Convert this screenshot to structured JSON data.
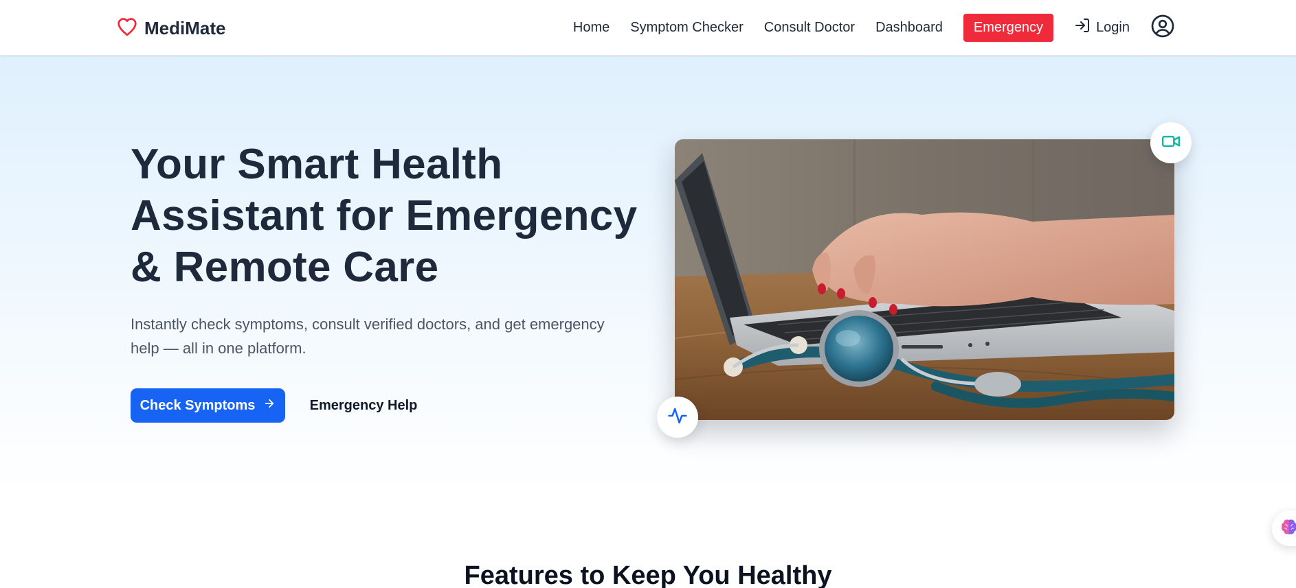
{
  "brand": {
    "name": "MediMate",
    "icon": "heart-icon",
    "icon_color": "#ef2b3b"
  },
  "nav": {
    "items": [
      {
        "label": "Home"
      },
      {
        "label": "Symptom Checker"
      },
      {
        "label": "Consult Doctor"
      },
      {
        "label": "Dashboard"
      }
    ],
    "emergency_label": "Emergency",
    "login_label": "Login"
  },
  "hero": {
    "title": "Your Smart Health Assistant for Emergency & Remote Care",
    "subtitle": "Instantly check symptoms, consult verified doctors, and get emergency help — all in one platform.",
    "primary_button": "Check Symptoms",
    "secondary_button": "Emergency Help"
  },
  "features": {
    "title": "Features to Keep You Healthy"
  },
  "colors": {
    "primary": "#1763f3",
    "emergency": "#ef2b3b",
    "heading": "#1e293b",
    "video_icon": "#14b8a6"
  }
}
